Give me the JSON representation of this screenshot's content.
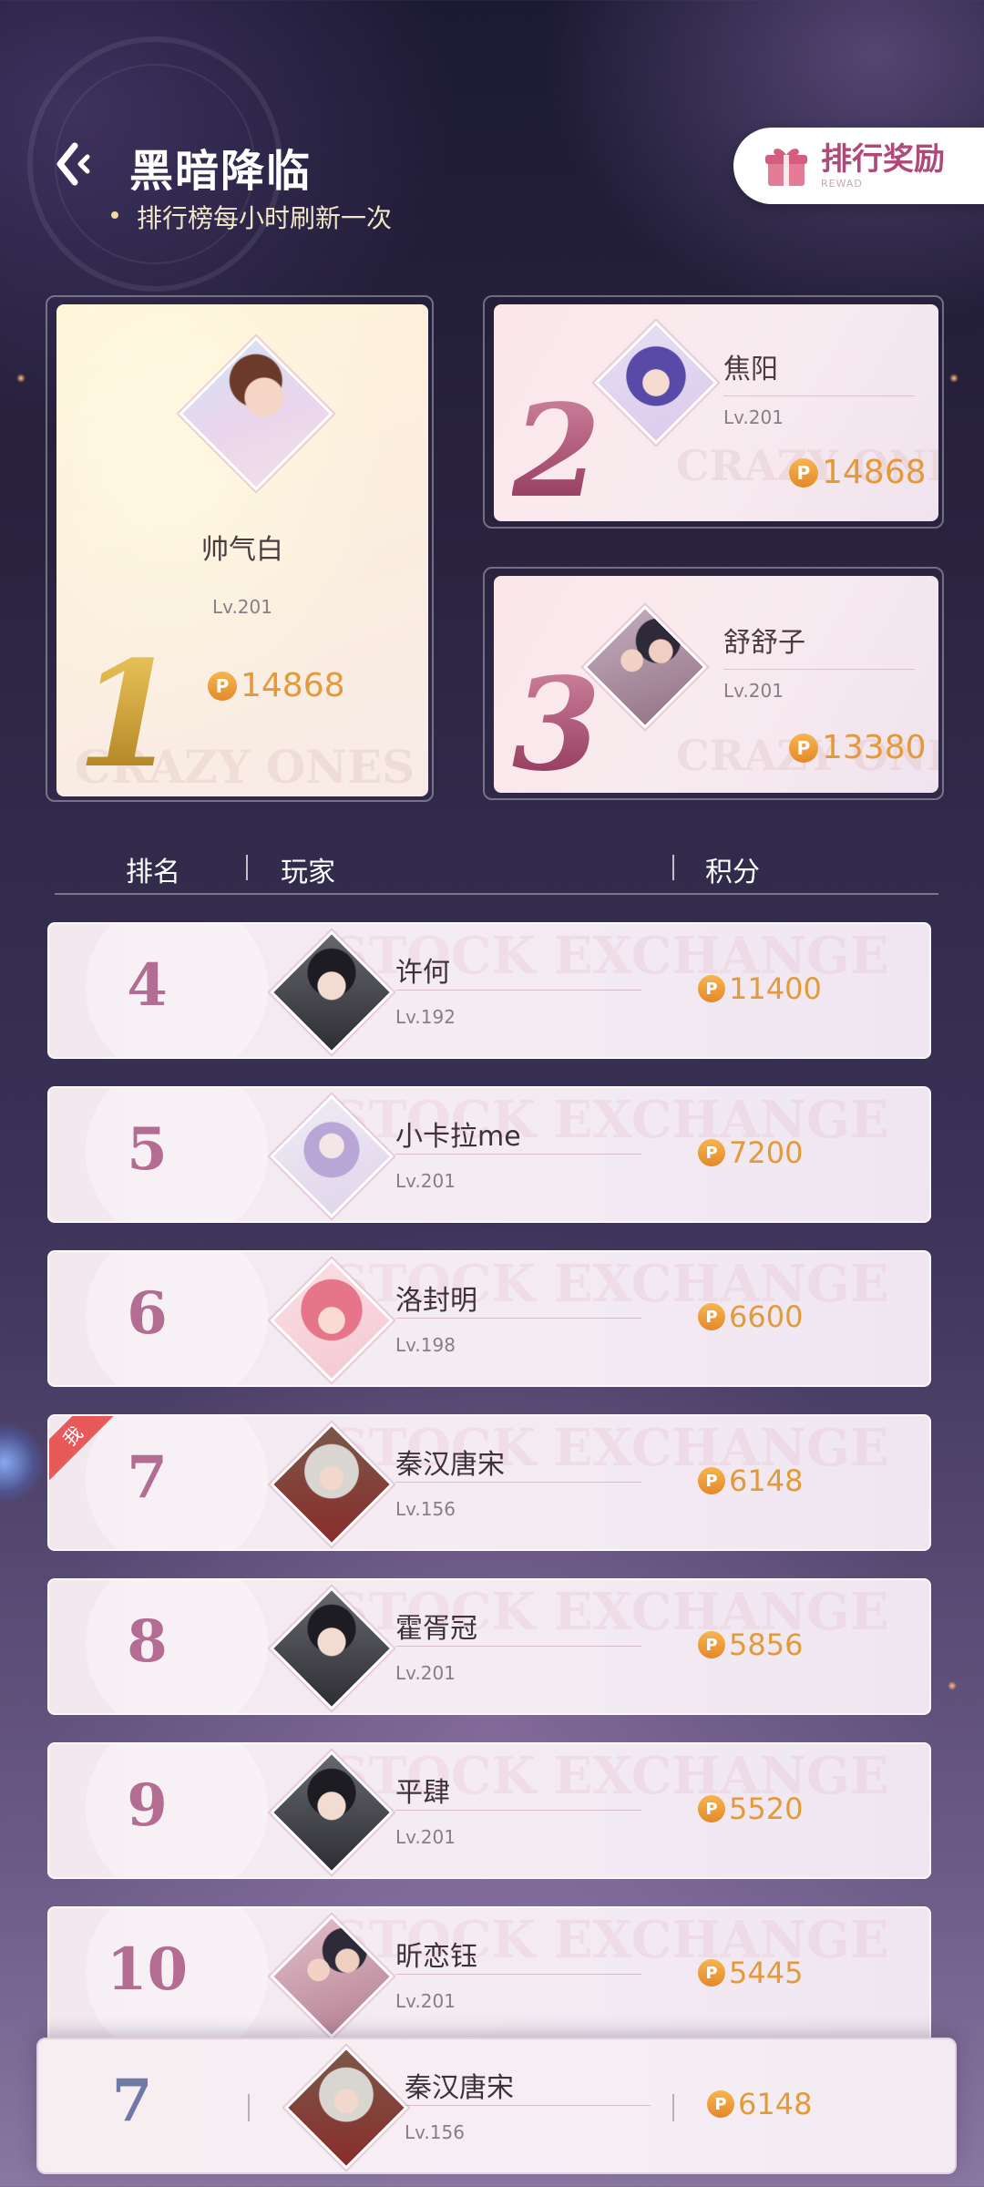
{
  "header": {
    "title": "黑暗降临",
    "subtitle": "排行榜每小时刷新一次",
    "reward_label": "排行奖励",
    "reward_sub": "REWAD"
  },
  "podium": [
    {
      "rank": "1",
      "name": "帅气白",
      "level": "Lv.201",
      "score": "14868",
      "watermark": "CRAZY ONES"
    },
    {
      "rank": "2",
      "name": "焦阳",
      "level": "Lv.201",
      "score": "14868",
      "watermark": "CRAZY ONES"
    },
    {
      "rank": "3",
      "name": "舒舒子",
      "level": "Lv.201",
      "score": "13380",
      "watermark": "CRAZY ONES"
    }
  ],
  "list_header": {
    "rank": "排名",
    "player": "玩家",
    "score": "积分"
  },
  "row_watermark": "STOCK EXCHANGE",
  "rows": [
    {
      "rank": "4",
      "name": "许何",
      "level": "Lv.192",
      "score": "11400"
    },
    {
      "rank": "5",
      "name": "小卡拉me",
      "level": "Lv.201",
      "score": "7200"
    },
    {
      "rank": "6",
      "name": "洛封明",
      "level": "Lv.198",
      "score": "6600"
    },
    {
      "rank": "7",
      "name": "秦汉唐宋",
      "level": "Lv.156",
      "score": "6148",
      "tag": "我"
    },
    {
      "rank": "8",
      "name": "霍胥冠",
      "level": "Lv.201",
      "score": "5856"
    },
    {
      "rank": "9",
      "name": "平肆",
      "level": "Lv.201",
      "score": "5520"
    },
    {
      "rank": "10",
      "name": "昕恋钰",
      "level": "Lv.201",
      "score": "5445"
    }
  ],
  "self": {
    "rank": "7",
    "name": "秦汉唐宋",
    "level": "Lv.156",
    "score": "6148"
  },
  "coin_symbol": "P",
  "colors": {
    "accent_gold": "#e39a3b",
    "rank_rose": "#b46d92",
    "reward_pink": "#b0497a",
    "me_tag": "#e85a5a"
  },
  "icons": {
    "back": "back-arrow-icon",
    "reward": "gift-icon",
    "coin": "points-coin-icon"
  }
}
